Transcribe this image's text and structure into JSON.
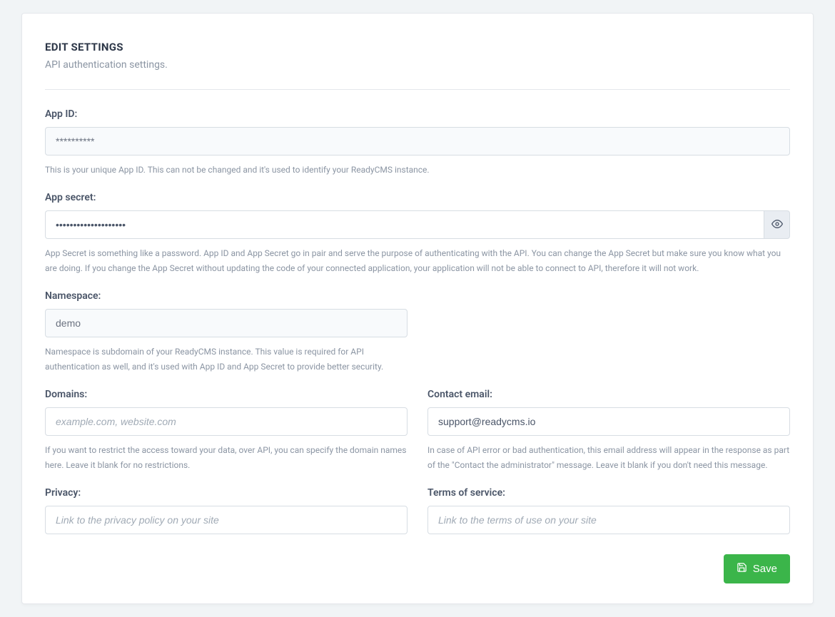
{
  "header": {
    "title": "EDIT SETTINGS",
    "subtitle": "API authentication settings."
  },
  "fields": {
    "app_id": {
      "label": "App ID:",
      "value": "**********",
      "help": "This is your unique App ID. This can not be changed and it's used to identify your ReadyCMS instance."
    },
    "app_secret": {
      "label": "App secret:",
      "value": "••••••••••••••••••••",
      "help": "App Secret is something like a password. App ID and App Secret go in pair and serve the purpose of authenticating with the API. You can change the App Secret but make sure you know what you are doing. If you change the App Secret without updating the code of your connected application, your application will not be able to connect to API, therefore it will not work."
    },
    "namespace": {
      "label": "Namespace:",
      "value": "demo",
      "help": "Namespace is subdomain of your ReadyCMS instance. This value is required for API authentication as well, and it's used with App ID and App Secret to provide better security."
    },
    "domains": {
      "label": "Domains:",
      "value": "",
      "placeholder": "example.com, website.com",
      "help": "If you want to restrict the access toward your data, over API, you can specify the domain names here. Leave it blank for no restrictions."
    },
    "contact_email": {
      "label": "Contact email:",
      "value": "support@readycms.io",
      "help": "In case of API error or bad authentication, this email address will appear in the response as part of the \"Contact the administrator\" message. Leave it blank if you don't need this message."
    },
    "privacy": {
      "label": "Privacy:",
      "value": "",
      "placeholder": "Link to the privacy policy on your site"
    },
    "terms": {
      "label": "Terms of service:",
      "value": "",
      "placeholder": "Link to the terms of use on your site"
    }
  },
  "actions": {
    "save_label": "Save"
  }
}
